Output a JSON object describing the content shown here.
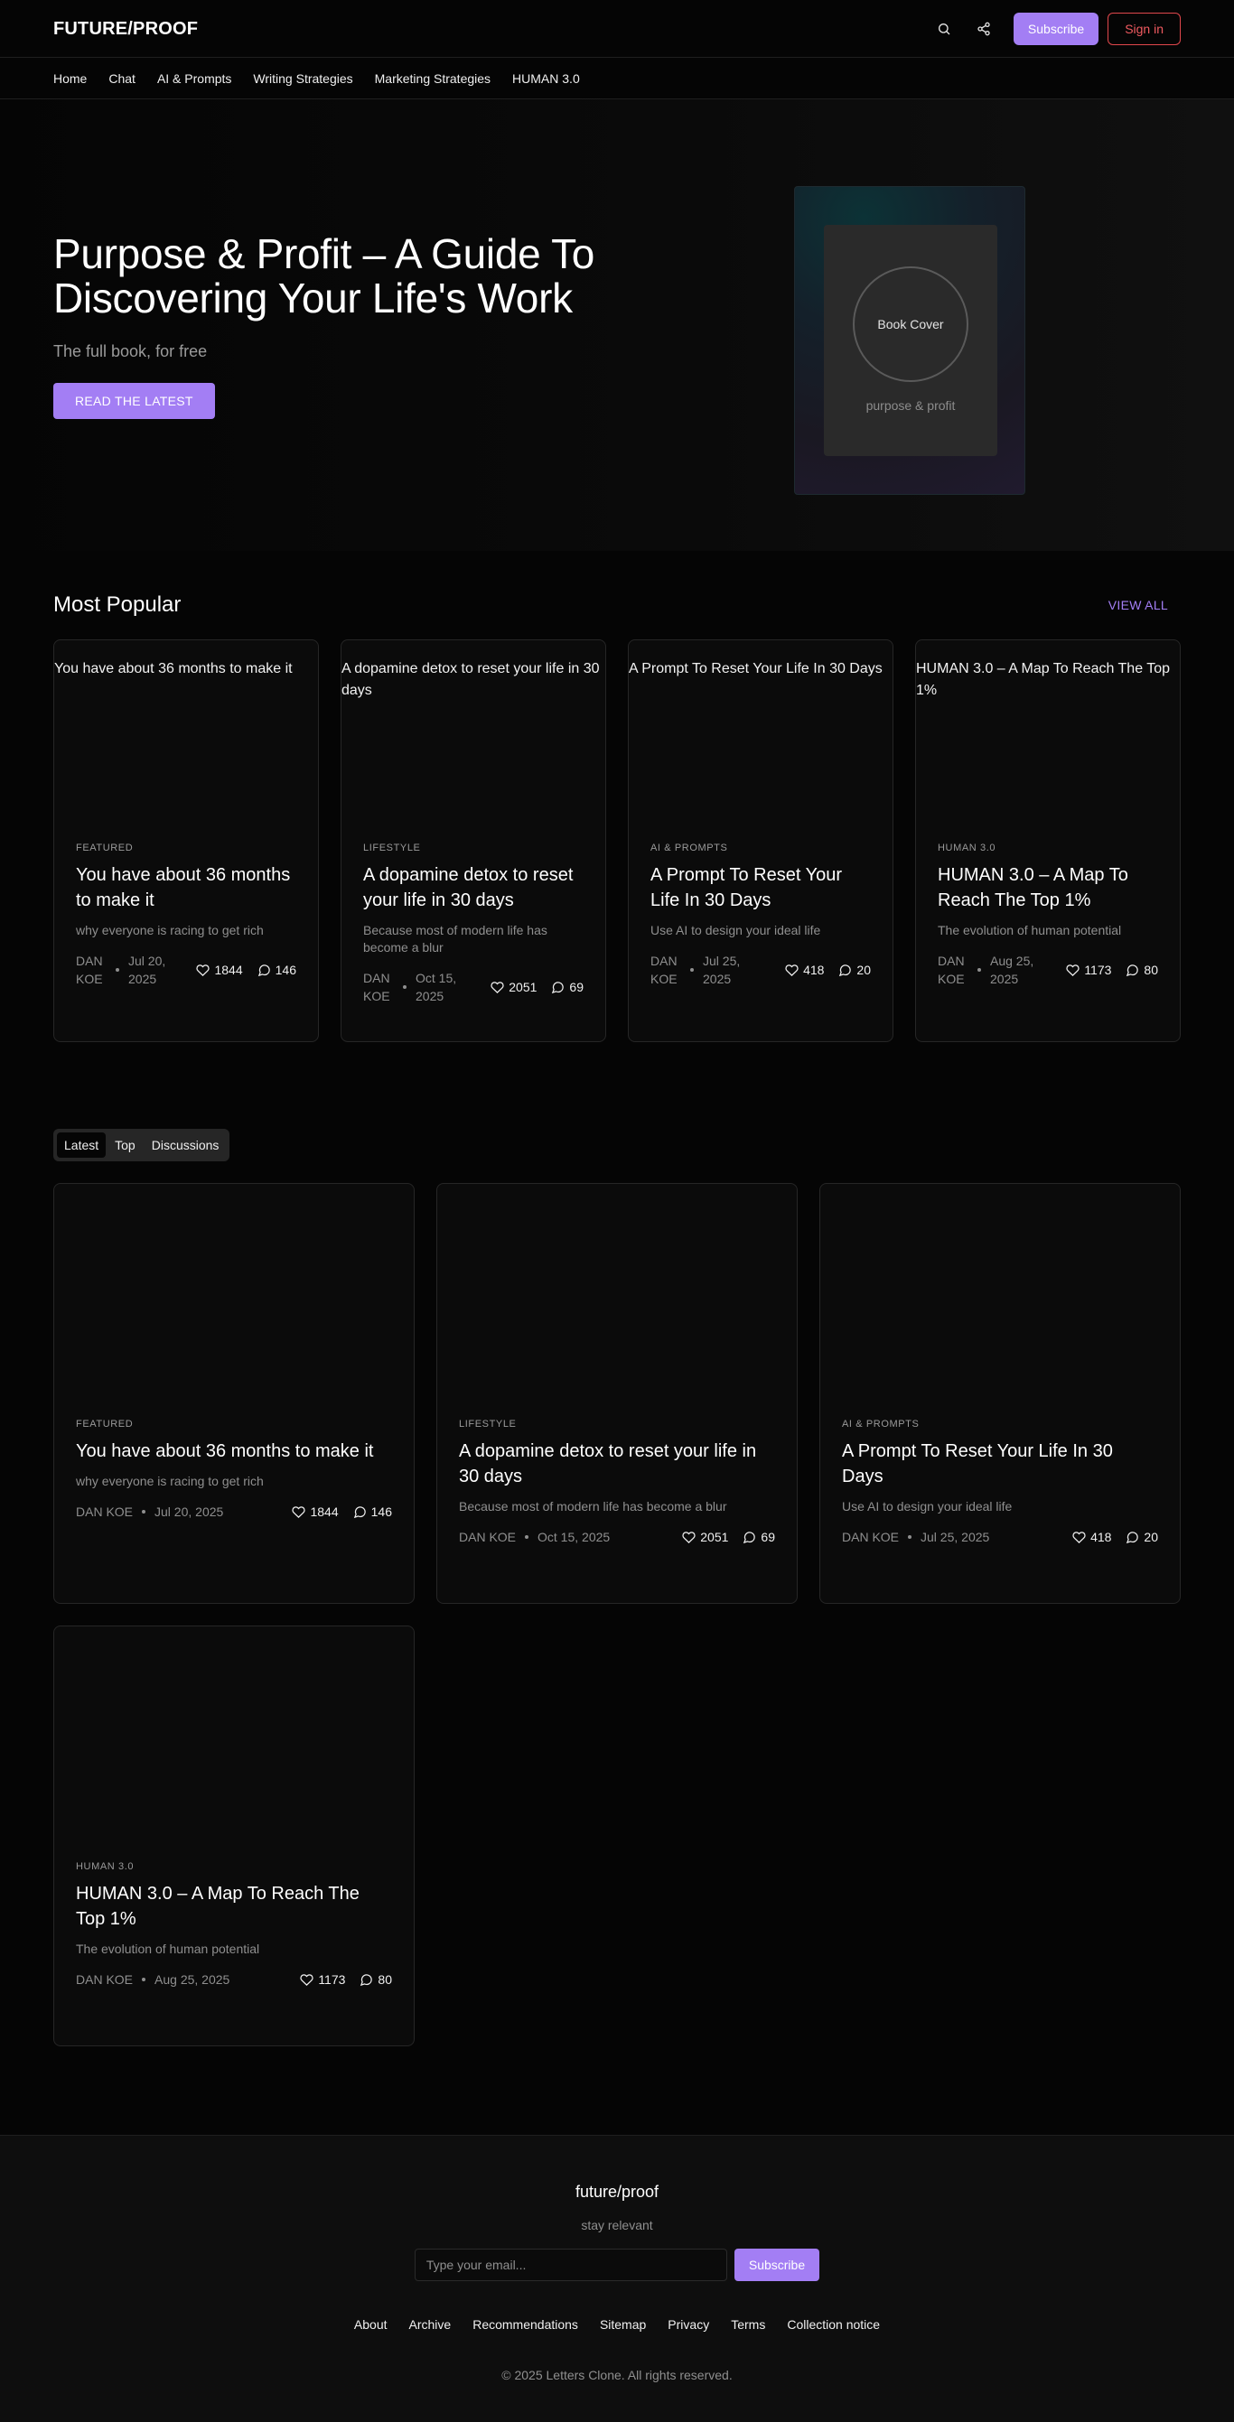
{
  "header": {
    "logo": "FUTURE/PROOF",
    "subscribe_label": "Subscribe",
    "signin_label": "Sign in"
  },
  "nav": [
    "Home",
    "Chat",
    "AI & Prompts",
    "Writing Strategies",
    "Marketing Strategies",
    "HUMAN 3.0"
  ],
  "hero": {
    "title": "Purpose & Profit – A Guide To Discovering Your Life's Work",
    "subtitle": "The full book, for free",
    "cta": "READ THE LATEST",
    "book_label": "Book Cover",
    "book_caption": "purpose & profit"
  },
  "popular": {
    "title": "Most Popular",
    "view_all": "VIEW ALL",
    "cards": [
      {
        "thumb": "You have about 36 months to make it",
        "tag": "FEATURED",
        "title": "You have about 36 months to make it",
        "desc": "why everyone is racing to get rich",
        "author": "DAN KOE",
        "date": "Jul 20, 2025",
        "likes": "1844",
        "comments": "146"
      },
      {
        "thumb": "A dopamine detox to reset your life in 30 days",
        "tag": "LIFESTYLE",
        "title": "A dopamine detox to reset your life in 30 days",
        "desc": "Because most of modern life has become a blur",
        "author": "DAN KOE",
        "date": "Oct 15, 2025",
        "likes": "2051",
        "comments": "69"
      },
      {
        "thumb": "A Prompt To Reset Your Life In 30 Days",
        "tag": "AI & PROMPTS",
        "title": "A Prompt To Reset Your Life In 30 Days",
        "desc": "Use AI to design your ideal life",
        "author": "DAN KOE",
        "date": "Jul 25, 2025",
        "likes": "418",
        "comments": "20"
      },
      {
        "thumb": "HUMAN 3.0 – A Map To Reach The Top 1%",
        "tag": "HUMAN 3.0",
        "title": "HUMAN 3.0 – A Map To Reach The Top 1%",
        "desc": "The evolution of human potential",
        "author": "DAN KOE",
        "date": "Aug 25, 2025",
        "likes": "1173",
        "comments": "80"
      }
    ]
  },
  "tabs": [
    "Latest",
    "Top",
    "Discussions"
  ],
  "latest": {
    "cards": [
      {
        "tag": "FEATURED",
        "title": "You have about 36 months to make it",
        "desc": "why everyone is racing to get rich",
        "author": "DAN KOE",
        "date": "Jul 20, 2025",
        "likes": "1844",
        "comments": "146"
      },
      {
        "tag": "LIFESTYLE",
        "title": "A dopamine detox to reset your life in 30 days",
        "desc": "Because most of modern life has become a blur",
        "author": "DAN KOE",
        "date": "Oct 15, 2025",
        "likes": "2051",
        "comments": "69"
      },
      {
        "tag": "AI & PROMPTS",
        "title": "A Prompt To Reset Your Life In 30 Days",
        "desc": "Use AI to design your ideal life",
        "author": "DAN KOE",
        "date": "Jul 25, 2025",
        "likes": "418",
        "comments": "20"
      },
      {
        "tag": "HUMAN 3.0",
        "title": "HUMAN 3.0 – A Map To Reach The Top 1%",
        "desc": "The evolution of human potential",
        "author": "DAN KOE",
        "date": "Aug 25, 2025",
        "likes": "1173",
        "comments": "80"
      }
    ]
  },
  "footer": {
    "logo": "future/proof",
    "tagline": "stay relevant",
    "email_placeholder": "Type your email...",
    "subscribe_label": "Subscribe",
    "links": [
      "About",
      "Archive",
      "Recommendations",
      "Sitemap",
      "Privacy",
      "Terms",
      "Collection notice"
    ],
    "copyright": "© 2025 Letters Clone. All rights reserved."
  },
  "colors": {
    "accent": "#a37ef4",
    "danger": "#e0474c",
    "background": "#050505"
  },
  "icons": {
    "search": "search-icon",
    "share": "share-icon",
    "like": "heart-icon",
    "comment": "comment-icon"
  }
}
